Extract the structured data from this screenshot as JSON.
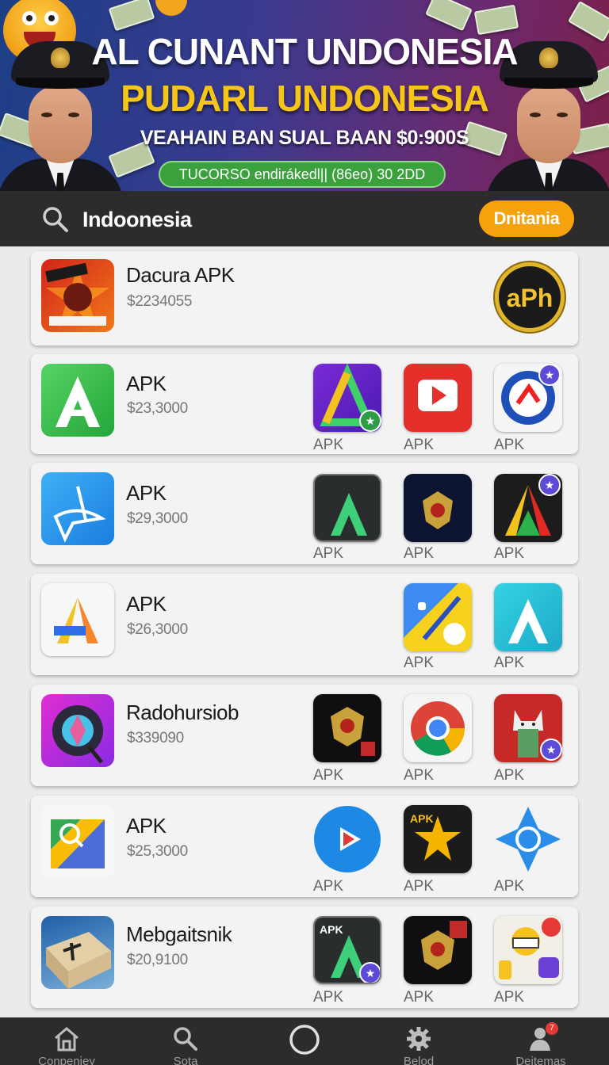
{
  "banner": {
    "title_line1": "AL CUNANT UNDONESIA",
    "title_line2": "PUDARL UNDONESIA",
    "subtitle": "VEAHAIN BAN SUAL BAAN $0:900S",
    "pill_text": "TUCORSO endirákedl|| (86eo) 30 2DD",
    "colors": {
      "title": "#ffffff",
      "title2": "#f5c518",
      "pill": "#3aa13c"
    }
  },
  "search": {
    "query": "Indoonesia",
    "button_label": "Dnitania",
    "button_color": "#f6a20d"
  },
  "apps": [
    {
      "title": "Dacura APK",
      "price": "$2234055",
      "badge_text": "aPh",
      "icon": "flag-emblem-icon",
      "minis": []
    },
    {
      "title": "APK",
      "price": "$23,3000",
      "icon": "green-a-icon",
      "minis": [
        {
          "label": "APK",
          "icon": "purple-a-icon"
        },
        {
          "label": "APK",
          "icon": "red-play-icon"
        },
        {
          "label": "APK",
          "icon": "blue-circle-icon"
        }
      ]
    },
    {
      "title": "APK",
      "price": "$29,3000",
      "icon": "blue-plane-icon",
      "minis": [
        {
          "label": "APK",
          "icon": "dark-apk-a-icon"
        },
        {
          "label": "APK",
          "icon": "emblem-icon"
        },
        {
          "label": "APK",
          "icon": "tricolor-a-icon"
        }
      ]
    },
    {
      "title": "APK",
      "price": "$26,3000",
      "icon": "gradient-a-icon",
      "minis": [
        {
          "label": "APK",
          "icon": "yellow-pen-icon"
        },
        {
          "label": "APK",
          "icon": "cyan-apk-a-icon"
        }
      ]
    },
    {
      "title": "Radohursiob",
      "price": "$339090",
      "icon": "magenta-wheel-icon",
      "minis": [
        {
          "label": "APK",
          "icon": "emblem-icon"
        },
        {
          "label": "APK",
          "icon": "chrome-icon"
        },
        {
          "label": "APK",
          "icon": "cat-icon"
        }
      ]
    },
    {
      "title": "APK",
      "price": "$25,3000",
      "icon": "maps-icon",
      "minis": [
        {
          "label": "APK",
          "icon": "blue-play-icon"
        },
        {
          "label": "APK",
          "icon": "star-a-icon"
        },
        {
          "label": "APK",
          "icon": "compass-icon"
        }
      ]
    },
    {
      "title": "Mebgaitsnik",
      "price": "$20,9100",
      "icon": "box-icon",
      "minis": [
        {
          "label": "APK",
          "icon": "dark-apk-a-icon"
        },
        {
          "label": "APK",
          "icon": "emblem-icon"
        },
        {
          "label": "APK",
          "icon": "collage-icon"
        }
      ]
    }
  ],
  "nav": [
    {
      "label": "Conpeniey",
      "icon": "home-icon"
    },
    {
      "label": "Sota",
      "icon": "search-icon"
    },
    {
      "label": "",
      "icon": "circle-icon"
    },
    {
      "label": "Belod",
      "icon": "gear-icon"
    },
    {
      "label": "Deitemas",
      "icon": "user-icon"
    }
  ],
  "nav_badge": "7"
}
